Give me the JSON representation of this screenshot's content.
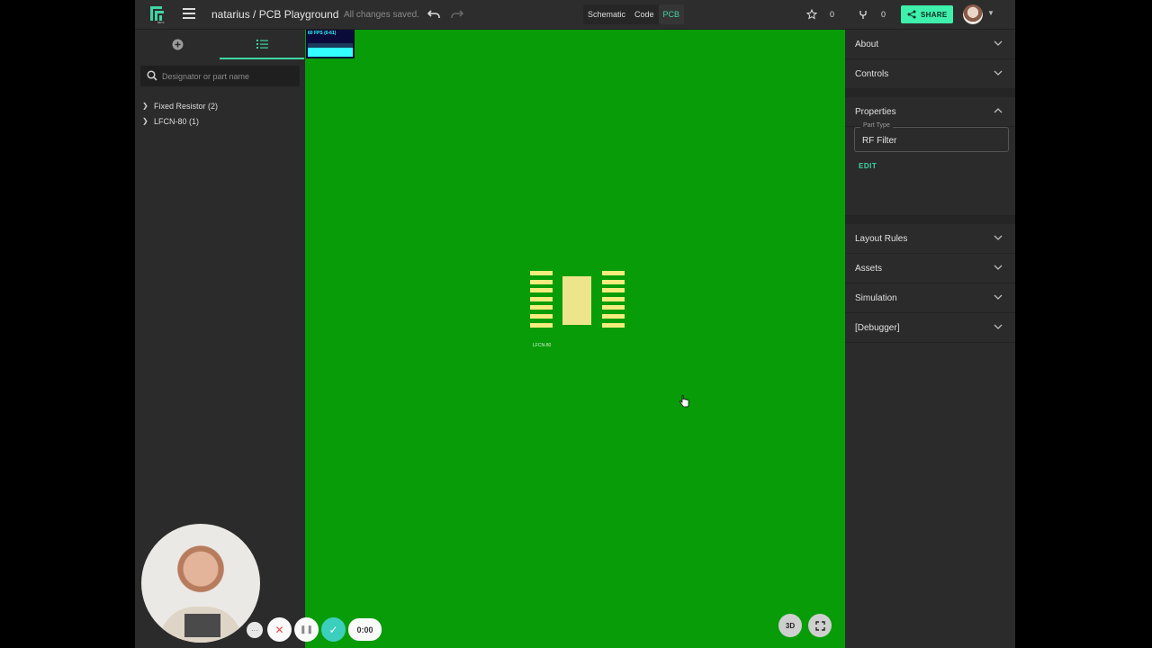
{
  "header": {
    "project_title": "natarius / PCB Playground",
    "save_status": "All changes saved.",
    "view_tabs": [
      {
        "label": "Schematic",
        "active": false
      },
      {
        "label": "Code",
        "active": false
      },
      {
        "label": "PCB",
        "active": true
      }
    ],
    "star_count": "0",
    "fork_count": "0",
    "share_label": "SHARE",
    "accent_color": "#3ef0ab"
  },
  "left_panel": {
    "search_placeholder": "Designator or part name",
    "tree": [
      {
        "label": "Fixed Resistor (2)",
        "icon": "chevron-right-icon"
      },
      {
        "label": "LFCN-80 (1)",
        "icon": "chevron-right-icon"
      }
    ]
  },
  "canvas": {
    "background_color": "#089c09",
    "fps_label": "60 FPS (0-61)",
    "component_label": "LFCN-80",
    "btn_3d_label": "3D"
  },
  "right_panel": {
    "sections_top": [
      {
        "label": "About",
        "icon": "chevron-down-icon"
      },
      {
        "label": "Controls",
        "icon": "chevron-down-icon"
      }
    ],
    "properties": {
      "label": "Properties",
      "icon": "chevron-up-icon",
      "part_type_label": "Part Type",
      "part_type_value": "RF Filter",
      "edit_label": "EDIT"
    },
    "sections_bottom": [
      {
        "label": "Layout Rules",
        "icon": "chevron-down-icon"
      },
      {
        "label": "Assets",
        "icon": "chevron-down-icon"
      },
      {
        "label": "Simulation",
        "icon": "chevron-down-icon"
      },
      {
        "label": "[Debugger]",
        "icon": "chevron-down-icon"
      }
    ]
  },
  "recorder": {
    "more_label": "···",
    "cancel_label": "✕",
    "pause_label": "❚❚",
    "done_label": "✓",
    "timer": "0:00"
  }
}
